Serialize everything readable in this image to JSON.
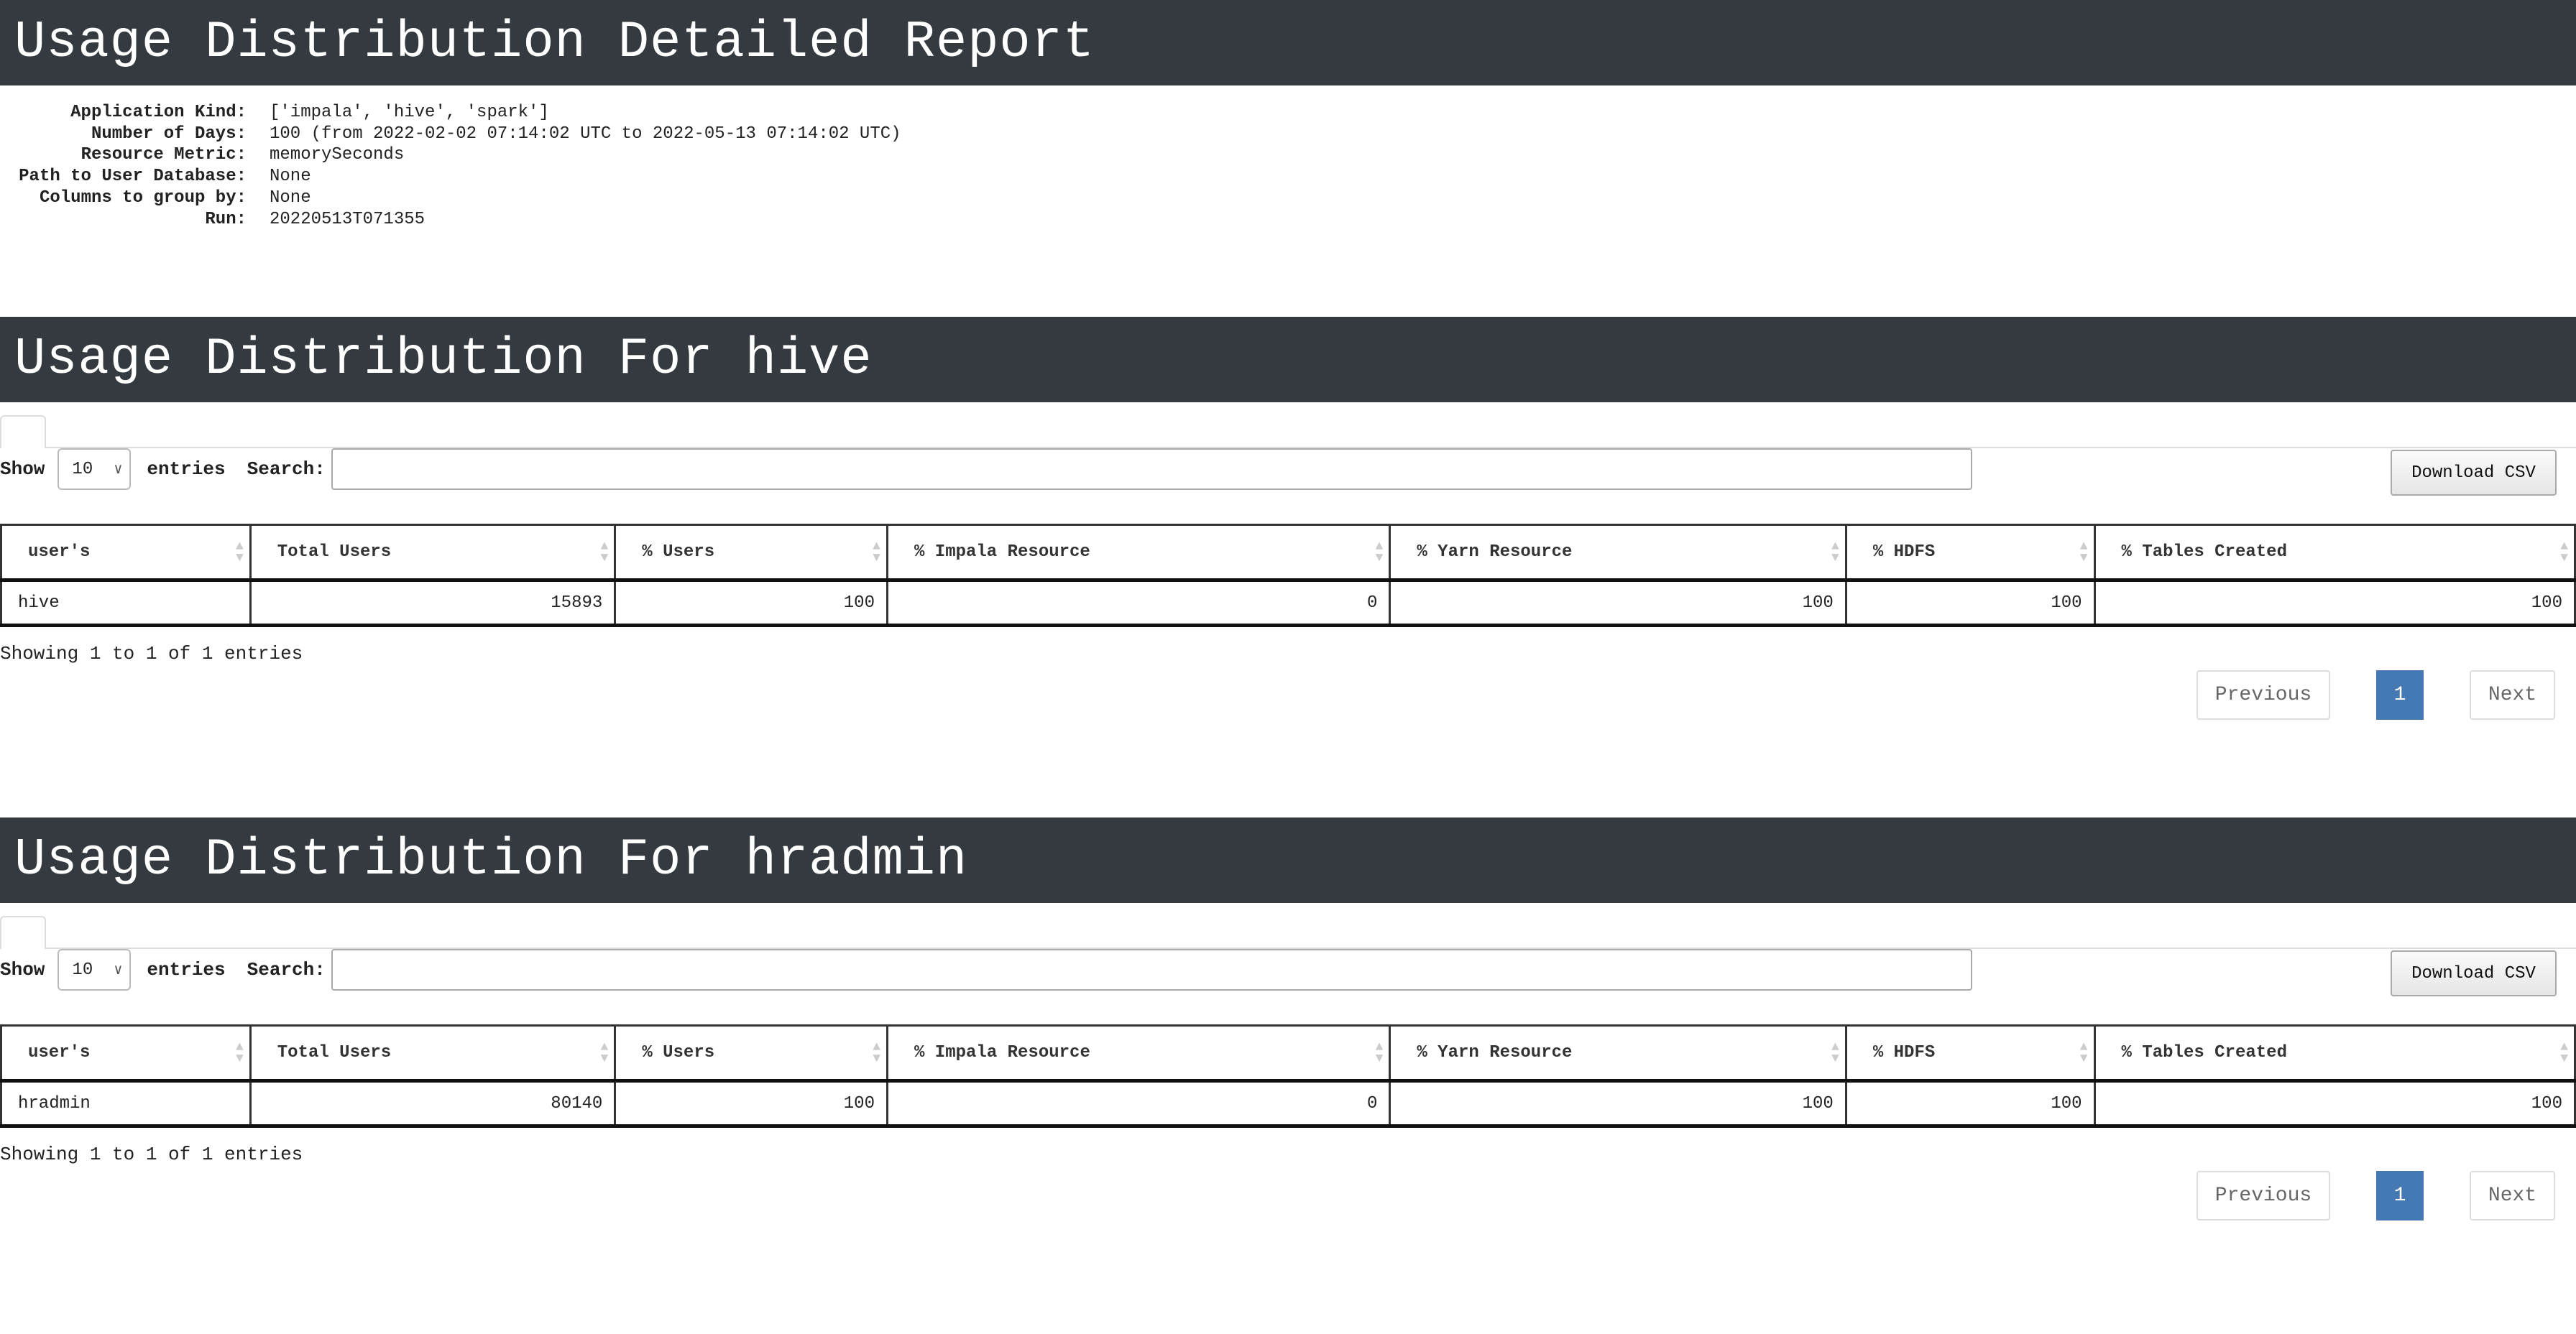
{
  "report": {
    "title": "Usage Distribution Detailed Report",
    "info": [
      {
        "label": "Application Kind:",
        "value": "['impala', 'hive', 'spark']"
      },
      {
        "label": "Number of Days:",
        "value": "100 (from 2022-02-02 07:14:02 UTC to 2022-05-13 07:14:02 UTC)"
      },
      {
        "label": "Resource Metric:",
        "value": "memorySeconds"
      },
      {
        "label": "Path to User Database:",
        "value": "None"
      },
      {
        "label": "Columns to group by:",
        "value": "None"
      },
      {
        "label": "Run:",
        "value": "20220513T071355"
      }
    ]
  },
  "controls": {
    "show": "Show",
    "entries_select": "10",
    "entries": "entries",
    "search": "Search:",
    "search_value": "",
    "download": "Download CSV",
    "previous": "Previous",
    "page": "1",
    "next": "Next"
  },
  "columns": [
    "user's",
    "Total Users",
    "% Users",
    "% Impala Resource",
    "% Yarn Resource",
    "% HDFS",
    "% Tables Created"
  ],
  "sections": [
    {
      "title": "Usage Distribution For hive",
      "row": [
        "hive",
        "15893",
        "100",
        "0",
        "100",
        "100",
        "100"
      ],
      "showing": "Showing 1 to 1 of 1 entries"
    },
    {
      "title": "Usage Distribution For hradmin",
      "row": [
        "hradmin",
        "80140",
        "100",
        "0",
        "100",
        "100",
        "100"
      ],
      "showing": "Showing 1 to 1 of 1 entries"
    }
  ],
  "colors": {
    "header_bg": "#343a40",
    "page_active": "#4479b3"
  }
}
